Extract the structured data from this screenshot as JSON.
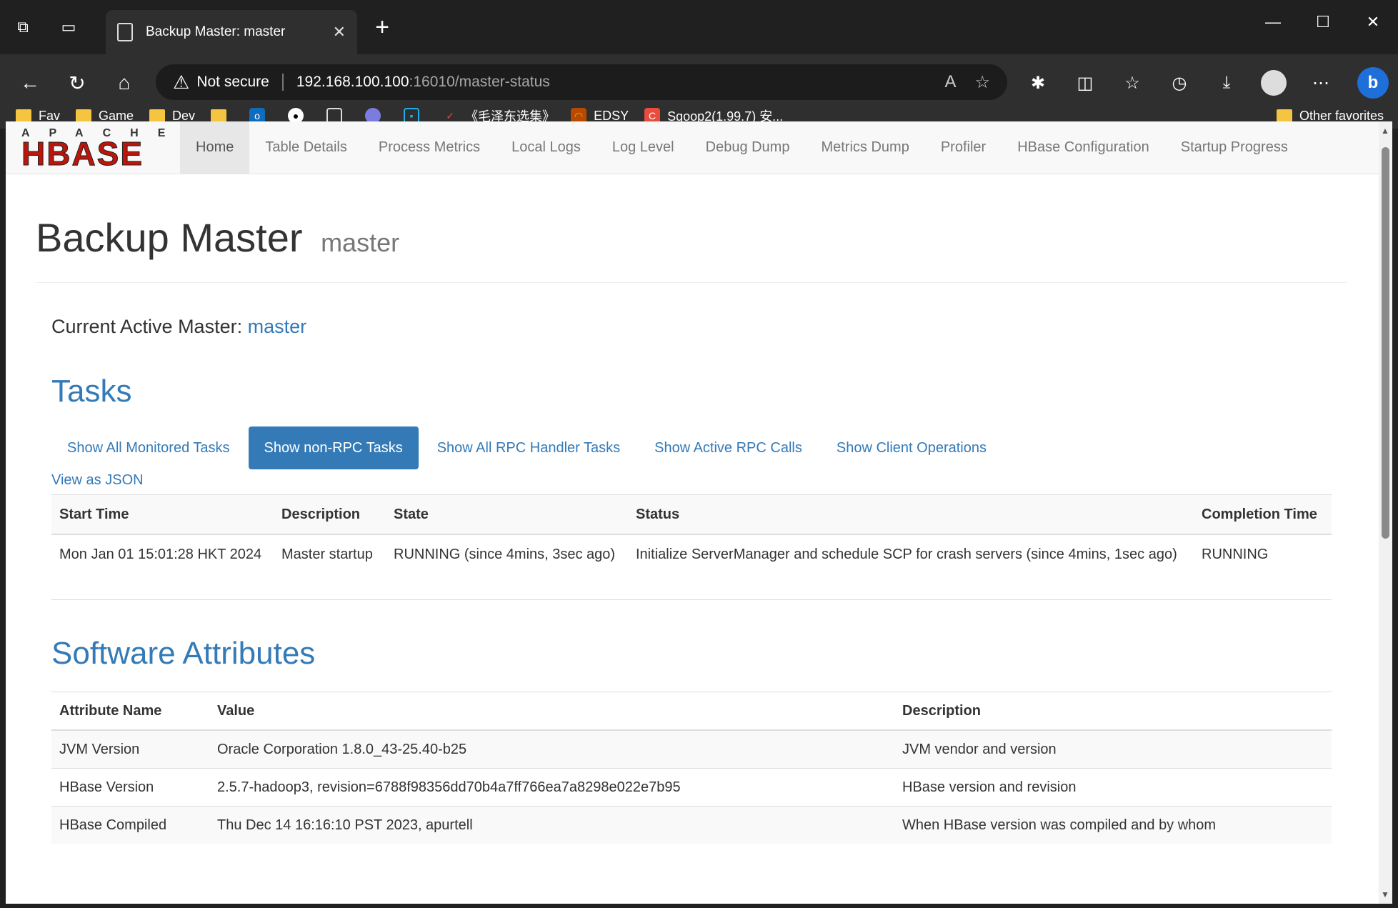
{
  "browser": {
    "tab_title": "Backup Master: master",
    "security_label": "Not secure",
    "url_host": "192.168.100.100",
    "url_rest": ":16010/master-status",
    "bookmarks": [
      "Fav",
      "Game",
      "Dev",
      "《毛泽东选集》",
      "EDSY",
      "Sqoop2(1.99.7) 安..."
    ],
    "other_favorites": "Other favorites"
  },
  "navbar": {
    "logo_top": "APACHE",
    "logo_bottom": "HBASE",
    "items": [
      "Home",
      "Table Details",
      "Process Metrics",
      "Local Logs",
      "Log Level",
      "Debug Dump",
      "Metrics Dump",
      "Profiler",
      "HBase Configuration",
      "Startup Progress"
    ]
  },
  "header": {
    "title": "Backup Master",
    "subtitle": "master"
  },
  "active_master": {
    "label": "Current Active Master:",
    "value": "master"
  },
  "tasks": {
    "heading": "Tasks",
    "pills": [
      "Show All Monitored Tasks",
      "Show non-RPC Tasks",
      "Show All RPC Handler Tasks",
      "Show Active RPC Calls",
      "Show Client Operations"
    ],
    "json_link": "View as JSON",
    "columns": [
      "Start Time",
      "Description",
      "State",
      "Status",
      "Completion Time"
    ],
    "rows": [
      {
        "start": "Mon Jan 01 15:01:28 HKT 2024",
        "description": "Master startup",
        "state": "RUNNING (since 4mins, 3sec ago)",
        "status": "Initialize ServerManager and schedule SCP for crash servers (since 4mins, 1sec ago)",
        "completion": "RUNNING"
      }
    ]
  },
  "software": {
    "heading": "Software Attributes",
    "columns": [
      "Attribute Name",
      "Value",
      "Description"
    ],
    "rows": [
      {
        "name": "JVM Version",
        "value": "Oracle Corporation 1.8.0_43-25.40-b25",
        "description": "JVM vendor and version"
      },
      {
        "name": "HBase Version",
        "value": "2.5.7-hadoop3, revision=6788f98356dd70b4a7ff766ea7a8298e022e7b95",
        "description": "HBase version and revision"
      },
      {
        "name": "HBase Compiled",
        "value": "Thu Dec 14 16:16:10 PST 2023, apurtell",
        "description": "When HBase version was compiled and by whom"
      }
    ]
  }
}
